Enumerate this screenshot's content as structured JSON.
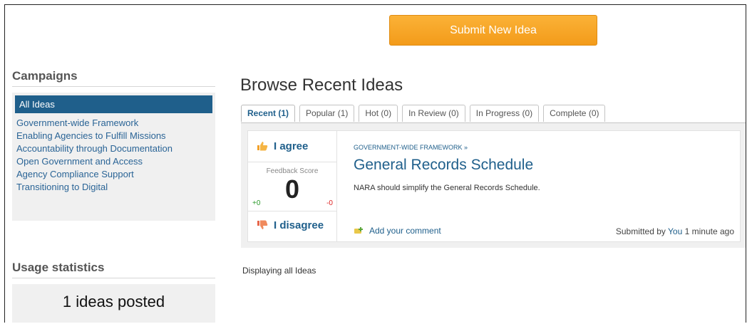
{
  "header": {
    "submit_button": "Submit New Idea"
  },
  "sidebar": {
    "campaigns_title": "Campaigns",
    "active": "All Ideas",
    "items": [
      "Government-wide Framework",
      "Enabling Agencies to Fulfill Missions",
      "Accountability through Documentation",
      "Open Government and Access",
      "Agency Compliance Support",
      "Transitioning to Digital"
    ],
    "usage_title": "Usage statistics",
    "usage_count": "1",
    "usage_label": "ideas posted"
  },
  "main": {
    "title": "Browse Recent Ideas",
    "tabs": [
      "Recent (1)",
      "Popular (1)",
      "Hot (0)",
      "In Review (0)",
      "In Progress (0)",
      "Complete (0)"
    ],
    "idea": {
      "agree_label": "I agree",
      "feedback_label": "Feedback Score",
      "score": "0",
      "plus": "+0",
      "minus": "-0",
      "disagree_label": "I disagree",
      "category": "GOVERNMENT-WIDE FRAMEWORK »",
      "title": "General Records Schedule",
      "description": "NARA should simplify the General Records Schedule.",
      "comment_label": "Add your comment",
      "submitted_prefix": "Submitted by",
      "submitted_user": "You",
      "submitted_time": "1 minute ago"
    },
    "footer_text": "Displaying all Ideas"
  }
}
